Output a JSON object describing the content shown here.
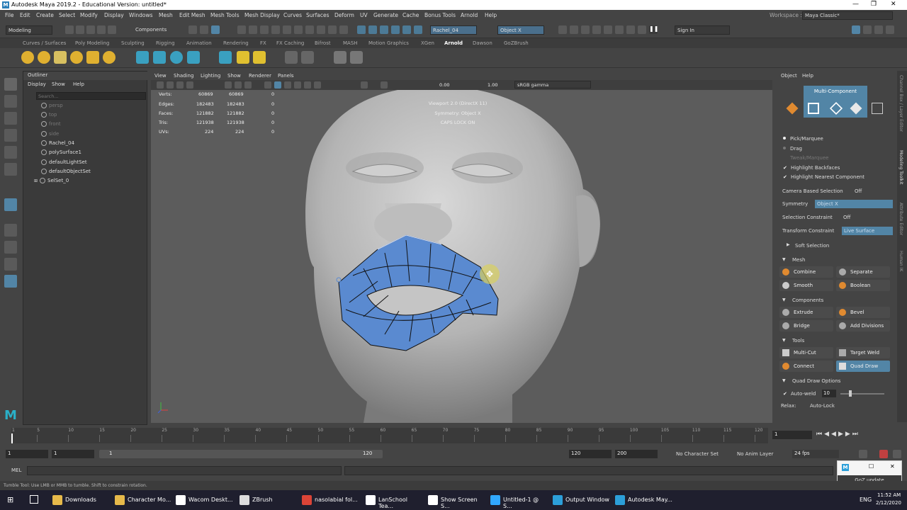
{
  "window": {
    "title": "Autodesk Maya 2019.2 - Educational Version: untitled*",
    "logo": "M",
    "minimize": "—",
    "maximize": "❐",
    "close": "✕"
  },
  "menubar": [
    "File",
    "Edit",
    "Create",
    "Select",
    "Modify",
    "Display",
    "Windows",
    "Mesh",
    "Edit Mesh",
    "Mesh Tools",
    "Mesh Display",
    "Curves",
    "Surfaces",
    "Deform",
    "UV",
    "Generate",
    "Cache",
    "Bonus Tools",
    "Arnold",
    "Help"
  ],
  "workspace": {
    "label": "Workspace :",
    "value": "Maya Classic*"
  },
  "statusline": {
    "mode": "Modeling",
    "components": "Components",
    "object_field": "Rachel_04",
    "symmetry_field": "Object X",
    "sign_in": "Sign In"
  },
  "shelf_tabs": [
    "Curves / Surfaces",
    "Poly Modeling",
    "Sculpting",
    "Rigging",
    "Animation",
    "Rendering",
    "FX",
    "FX Caching",
    "Bifrost",
    "MASH",
    "Motion Graphics",
    "XGen",
    "Arnold",
    "Dawson",
    "GoZBrush"
  ],
  "shelf_active_tab": "Arnold",
  "outliner": {
    "title": "Outliner",
    "menu": [
      "Display",
      "Show",
      "Help"
    ],
    "search_placeholder": "Search...",
    "items": [
      {
        "label": "persp",
        "dim": true
      },
      {
        "label": "top",
        "dim": true
      },
      {
        "label": "front",
        "dim": true
      },
      {
        "label": "side",
        "dim": true
      },
      {
        "label": "Rachel_04",
        "dim": false
      },
      {
        "label": "polySurface1",
        "dim": false
      },
      {
        "label": "defaultLightSet",
        "dim": false
      },
      {
        "label": "defaultObjectSet",
        "dim": false
      },
      {
        "label": "SelSet_0",
        "dim": false
      }
    ]
  },
  "viewport": {
    "menu": [
      "View",
      "Shading",
      "Lighting",
      "Show",
      "Renderer",
      "Panels"
    ],
    "exposure": "0.00",
    "gamma": "1.00",
    "colorspace": "sRGB gamma",
    "hud_stats": [
      {
        "label": "Verts:",
        "a": "60869",
        "b": "60869",
        "c": "0"
      },
      {
        "label": "Edges:",
        "a": "182483",
        "b": "182483",
        "c": "0"
      },
      {
        "label": "Faces:",
        "a": "121882",
        "b": "121882",
        "c": "0"
      },
      {
        "label": "Tris:",
        "a": "121938",
        "b": "121938",
        "c": "0"
      },
      {
        "label": "UVs:",
        "a": "224",
        "b": "224",
        "c": "0"
      }
    ],
    "hud_center": [
      "Viewport 2.0 (DirectX 11)",
      "Symmetry: Object X",
      "CAPS LOCK ON"
    ]
  },
  "modeling_toolkit": {
    "menu": [
      "Object",
      "Help"
    ],
    "multi_component": "Multi-Component",
    "selection_modes": [
      "Pick/Marquee",
      "Drag",
      "Tweak/Marquee"
    ],
    "checks": [
      "Highlight Backfaces",
      "Highlight Nearest Component"
    ],
    "camera_based_selection": {
      "label": "Camera Based Selection",
      "value": "Off"
    },
    "symmetry": {
      "label": "Symmetry",
      "value": "Object X"
    },
    "selection_constraint": {
      "label": "Selection Constraint",
      "value": "Off"
    },
    "transform_constraint": {
      "label": "Transform Constraint",
      "value": "Live Surface"
    },
    "soft_selection": "Soft Selection",
    "sections": {
      "mesh": {
        "title": "Mesh",
        "buttons": [
          "Combine",
          "Separate",
          "Smooth",
          "Boolean"
        ]
      },
      "components": {
        "title": "Components",
        "buttons": [
          "Extrude",
          "Bevel",
          "Bridge",
          "Add Divisions"
        ]
      },
      "tools": {
        "title": "Tools",
        "buttons": [
          "Multi-Cut",
          "Target Weld",
          "Connect",
          "Quad Draw"
        ]
      }
    },
    "quad_draw_options": "Quad Draw Options",
    "auto_weld": {
      "label": "Auto-weld",
      "value": "10"
    },
    "relax": {
      "label": "Relax:",
      "value": "Auto-Lock"
    }
  },
  "side_tabs": [
    "Channel Box / Layer Editor",
    "Modeling Toolkit",
    "Attribute Editor",
    "Human IK"
  ],
  "timeline": {
    "ticks": [
      "1",
      "5",
      "10",
      "15",
      "20",
      "25",
      "30",
      "35",
      "40",
      "45",
      "50",
      "55",
      "60",
      "65",
      "70",
      "75",
      "80",
      "85",
      "90",
      "95",
      "100",
      "105",
      "110",
      "115",
      "120"
    ],
    "current": "1"
  },
  "range": {
    "start": "1",
    "start2": "1",
    "slider_start": "1",
    "slider_end": "120",
    "end": "120",
    "end2": "200",
    "character": "No Character Set",
    "anim_layer": "No Anim Layer",
    "fps": "24 fps"
  },
  "cmdline": {
    "label": "MEL"
  },
  "helpline": "Tumble Tool: Use LMB or MMB to tumble. Shift to constrain rotation.",
  "goz_popup": {
    "label": "GoZ update"
  },
  "taskbar": {
    "items": [
      {
        "label": "Downloads",
        "color": "#e6b94a"
      },
      {
        "label": "Character Mo...",
        "color": "#e6b94a"
      },
      {
        "label": "Wacom Deskt...",
        "color": "#ffffff"
      },
      {
        "label": "ZBrush",
        "color": "#dddddd"
      },
      {
        "label": "nasolabial fol...",
        "color": "#db4437"
      },
      {
        "label": "LanSchool Tea...",
        "color": "#ffffff"
      },
      {
        "label": "Show Screen S...",
        "color": "#ffffff"
      },
      {
        "label": "Untitled-1 @ S...",
        "color": "#31a8ff"
      },
      {
        "label": "Output Window",
        "color": "#2c9fd9"
      },
      {
        "label": "Autodesk May...",
        "color": "#2c9fd9"
      }
    ],
    "lang": "ENG",
    "time": "11:52 AM",
    "date": "2/12/2020"
  }
}
